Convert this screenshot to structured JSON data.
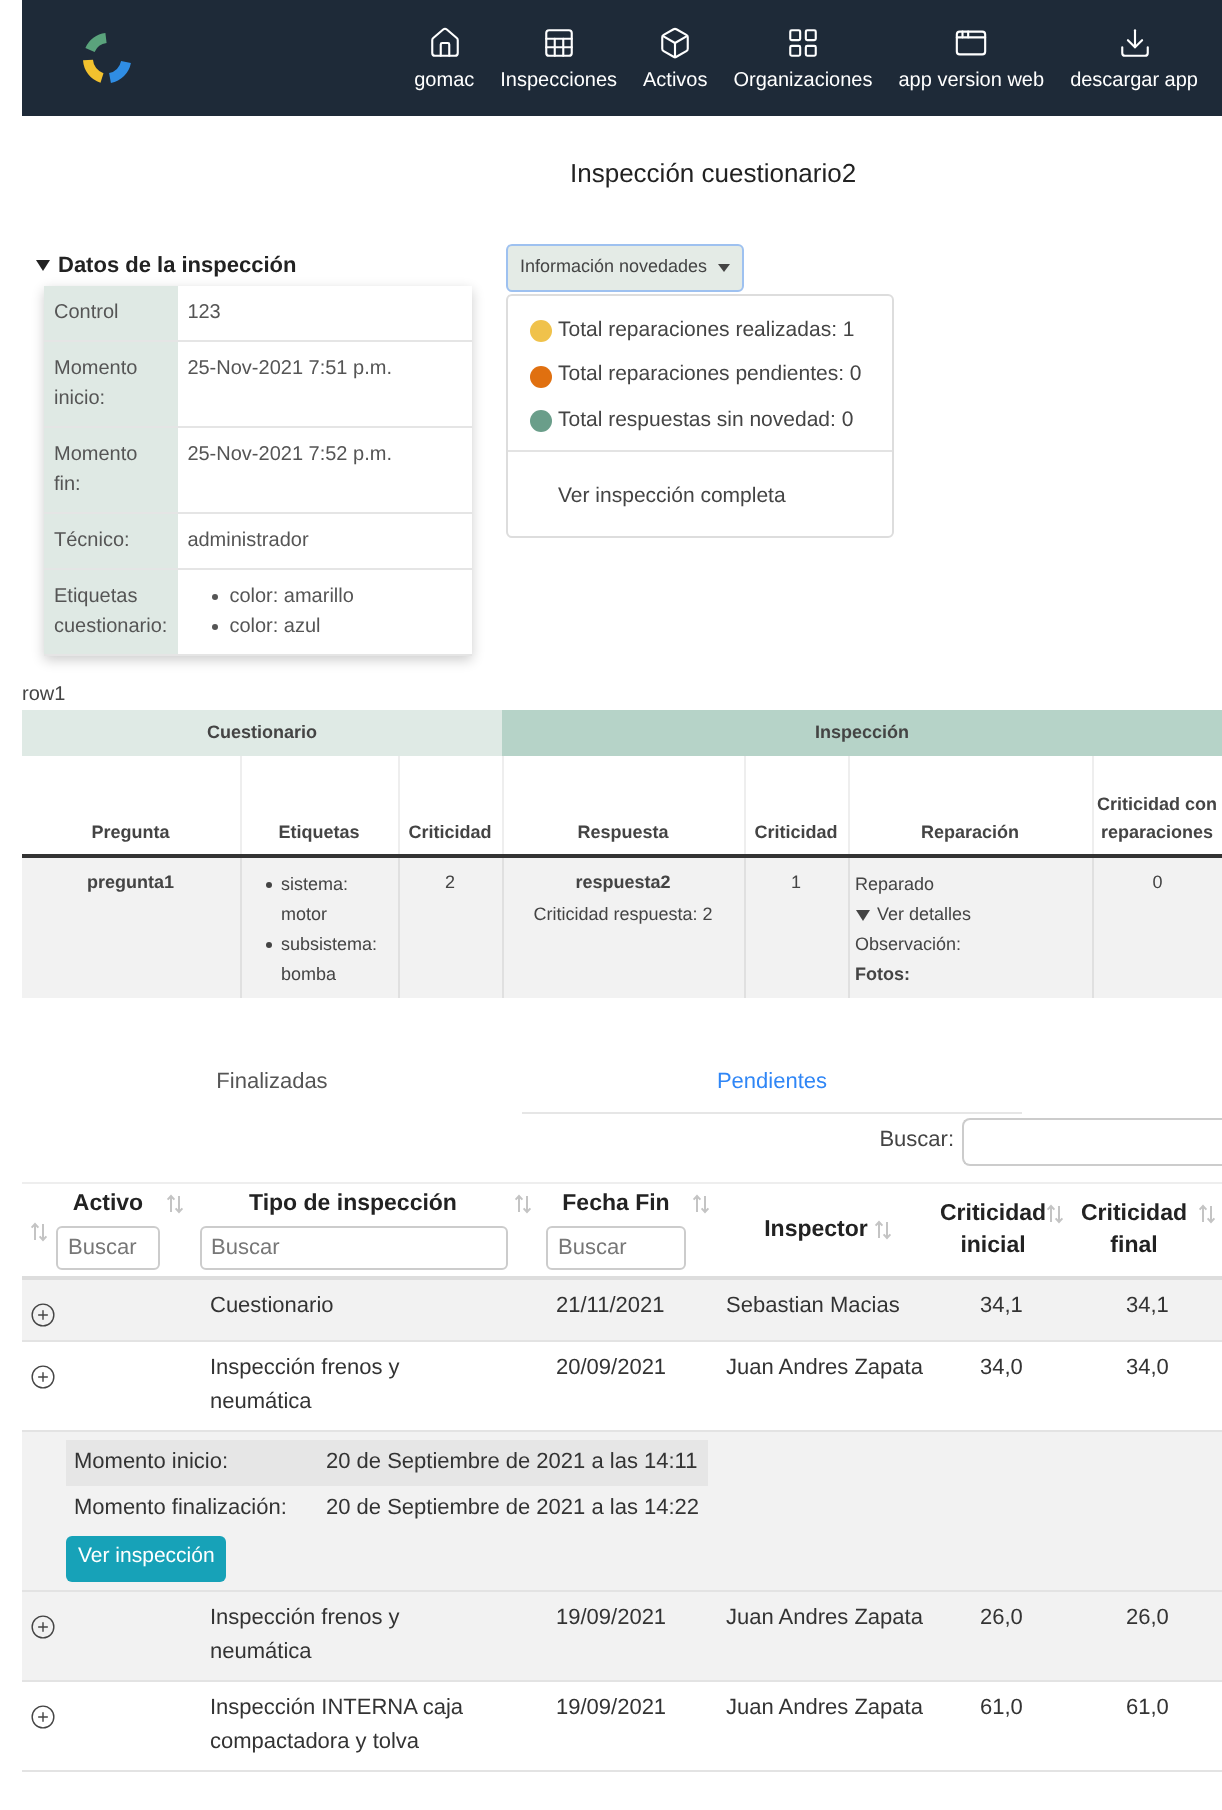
{
  "navbar": {
    "items": [
      {
        "label": "gomac"
      },
      {
        "label": "Inspecciones"
      },
      {
        "label": "Activos"
      },
      {
        "label": "Organizaciones"
      },
      {
        "label": "app version web"
      },
      {
        "label": "descargar app"
      }
    ]
  },
  "title": "Inspección cuestionario2",
  "details": {
    "title": "Datos de la inspección",
    "expanded": true,
    "rows": [
      {
        "label": "Control",
        "value": "123"
      },
      {
        "label": "Momento inicio:",
        "value": "25-Nov-2021 7:51 p.m."
      },
      {
        "label": "Momento fin:",
        "value": "25-Nov-2021 7:52 p.m."
      },
      {
        "label": "Técnico:",
        "value": "administrador"
      },
      {
        "label": "Etiquetas cuestionario:",
        "list": [
          "color: amarillo",
          "color: azul"
        ]
      }
    ]
  },
  "novedades": {
    "button": "Información novedades",
    "expanded": true,
    "items": [
      {
        "label": "Total reparaciones realizadas: 1",
        "color": "#f0c24b"
      },
      {
        "label": "Total reparaciones pendientes: 0",
        "color": "#e07010"
      },
      {
        "label": "Total respuestas sin novedad: 0",
        "color": "#6a9e8a"
      }
    ],
    "link": "Ver inspección completa"
  },
  "row_label": "row1",
  "answers_table": {
    "groups": [
      {
        "label": "Cuestionario",
        "columns": [
          "Pregunta",
          "Etiquetas",
          "Criticidad"
        ]
      },
      {
        "label": "Inspección",
        "columns": [
          "Respuesta",
          "Criticidad",
          "Reparación",
          "Criticidad con reparaciones"
        ]
      }
    ],
    "rows": [
      {
        "pregunta": "pregunta1",
        "etiquetas": [
          "sistema: motor",
          "subsistema: bomba"
        ],
        "criticidad": "2",
        "respuesta": "respuesta2",
        "respuesta_nota": "Criticidad respuesta: 2",
        "criticidad_respuesta": "1",
        "reparacion": {
          "estado": "Reparado",
          "detalles": "Ver detalles",
          "detalles_expanded": true,
          "observacion": "Observación:",
          "fotos": "Fotos:"
        },
        "criticidad_reparaciones": "0"
      }
    ]
  },
  "tabs": [
    {
      "label": "Finalizadas",
      "selected": false
    },
    {
      "label": "Pendientes",
      "selected": true
    }
  ],
  "search": {
    "label": "Buscar:"
  },
  "inspections_table": {
    "columns": [
      {
        "sortable": true
      },
      {
        "label": "Activo",
        "sortable": true,
        "filter_placeholder": "Buscar"
      },
      {
        "label": "Tipo de inspección",
        "sortable": true,
        "filter_placeholder": "Buscar"
      },
      {
        "label": "Fecha Fin",
        "sortable": true,
        "filter_placeholder": "Buscar"
      },
      {
        "label": "Inspector",
        "sortable": true
      },
      {
        "label": "Criticidad inicial",
        "sortable": true
      },
      {
        "label": "Criticidad final",
        "sortable": true
      }
    ],
    "rows": [
      {
        "tipo": "Cuestionario",
        "fecha": "21/11/2021",
        "inspector": "Sebastian Macias",
        "inicial": "34,1",
        "final": "34,1",
        "expanded": false
      },
      {
        "tipo": "Inspección frenos y neumática",
        "fecha": "20/09/2021",
        "inspector": "Juan Andres Zapata",
        "inicial": "34,0",
        "final": "34,0",
        "expanded": true,
        "detail": {
          "rows": [
            {
              "label": "Momento inicio:",
              "value": "20 de Septiembre de 2021 a las 14:11"
            },
            {
              "label": "Momento finalización:",
              "value": "20 de Septiembre de 2021 a las 14:22"
            }
          ],
          "button": "Ver inspección"
        }
      },
      {
        "tipo": "Inspección frenos y neumática",
        "fecha": "19/09/2021",
        "inspector": "Juan Andres Zapata",
        "inicial": "26,0",
        "final": "26,0",
        "expanded": false
      },
      {
        "tipo": "Inspección INTERNA caja compactadora y tolva",
        "fecha": "19/09/2021",
        "inspector": "Juan Andres Zapata",
        "inicial": "61,0",
        "final": "61,0",
        "expanded": false
      }
    ]
  }
}
